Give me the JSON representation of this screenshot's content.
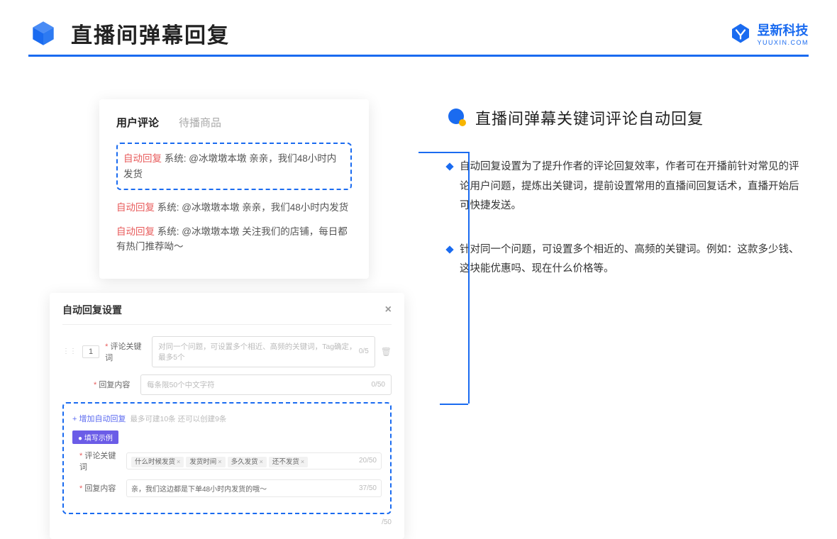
{
  "header": {
    "title": "直播间弹幕回复",
    "brand": "昱新科技",
    "brand_sub": "YUUXIN.COM"
  },
  "comments_card": {
    "tab_active": "用户评论",
    "tab_inactive": "待播商品",
    "highlighted": {
      "badge": "自动回复",
      "text": "系统: @冰墩墩本墩 亲亲，我们48小时内发货"
    },
    "line2": {
      "badge": "自动回复",
      "text": "系统: @冰墩墩本墩 亲亲，我们48小时内发货"
    },
    "line3": {
      "badge": "自动回复",
      "text": "系统: @冰墩墩本墩 关注我们的店铺，每日都有热门推荐呦～"
    }
  },
  "settings": {
    "title": "自动回复设置",
    "num": "1",
    "kw_label": "评论关键词",
    "kw_placeholder": "对同一个问题，可设置多个相近、高频的关键词，Tag确定，最多5个",
    "kw_count": "0/5",
    "content_label": "回复内容",
    "content_placeholder": "每条限50个中文字符",
    "content_count": "0/50",
    "add_link": "+ 增加自动回复",
    "add_note": "最多可建10条 还可以创建9条",
    "example_badge": "● 填写示例",
    "ex_kw_label": "评论关键词",
    "tags": [
      "什么时候发货",
      "发货时间",
      "多久发货",
      "还不发货"
    ],
    "ex_kw_count": "20/50",
    "ex_content_label": "回复内容",
    "ex_content_value": "亲，我们这边都是下单48小时内发货的哦～",
    "ex_content_count": "37/50",
    "outer_count": "/50"
  },
  "right": {
    "section_title": "直播间弹幕关键词评论自动回复",
    "bullet1": "自动回复设置为了提升作者的评论回复效率，作者可在开播前针对常见的评论用户问题，提炼出关键词，提前设置常用的直播间回复话术，直播开始后可快捷发送。",
    "bullet2": "针对同一个问题，可设置多个相近的、高频的关键词。例如：这款多少钱、这块能优惠吗、现在什么价格等。"
  }
}
